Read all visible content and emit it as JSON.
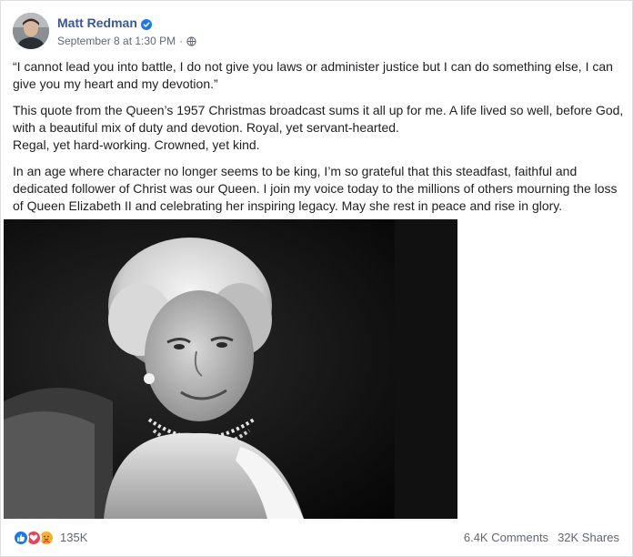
{
  "author": {
    "name": "Matt Redman",
    "verified_icon": "verified-badge-icon",
    "timestamp": "September 8 at 1:30 PM",
    "separator": "·",
    "audience_icon": "globe-icon"
  },
  "post": {
    "paragraphs": [
      "“I cannot lead you into battle, I do not give you laws or administer justice but I can do something else, I can give you my heart and my devotion.”",
      "This quote from the Queen’s 1957 Christmas broadcast sums it all up for me. A life lived so well, before God, with a beautiful mix of duty and devotion. Royal, yet servant-hearted.",
      "Regal, yet hard-working. Crowned, yet kind.",
      "In an age where character no longer seems to be king, I’m so grateful that this steadfast, faithful and dedicated follower of Christ was our Queen. I join my voice today to the millions of others mourning the loss of Queen Elizabeth II and celebrating her inspiring legacy. May she rest in peace and rise in glory."
    ],
    "photo_icon": "black-and-white-portrait-photo"
  },
  "footer": {
    "reaction_icons": [
      "like-icon",
      "love-icon",
      "care-icon"
    ],
    "reaction_count": "135K",
    "comments": "6.4K Comments",
    "shares": "32K Shares"
  },
  "colors": {
    "name_link": "#385898",
    "secondary_text": "#616770",
    "like_blue": "#1877f2",
    "love_red": "#f33e58",
    "care_yellow": "#f7b125"
  }
}
